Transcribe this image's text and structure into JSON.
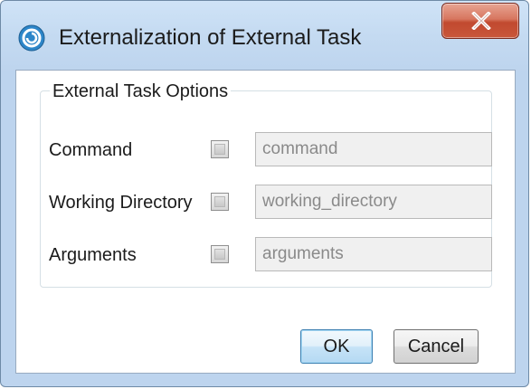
{
  "window": {
    "title": "Externalization of External Task",
    "icon": "app-logo-icon",
    "close_icon": "close-icon"
  },
  "group": {
    "legend": "External Task Options",
    "rows": [
      {
        "label": "Command",
        "checked": false,
        "value": "",
        "placeholder": "command"
      },
      {
        "label": "Working Directory",
        "checked": false,
        "value": "",
        "placeholder": "working_directory"
      },
      {
        "label": "Arguments",
        "checked": false,
        "value": "",
        "placeholder": "arguments"
      }
    ]
  },
  "buttons": {
    "ok_label": "OK",
    "cancel_label": "Cancel"
  },
  "colors": {
    "title_bar": "#c4daf1",
    "close_button": "#c9573b",
    "default_button_border": "#3c7fb1"
  }
}
